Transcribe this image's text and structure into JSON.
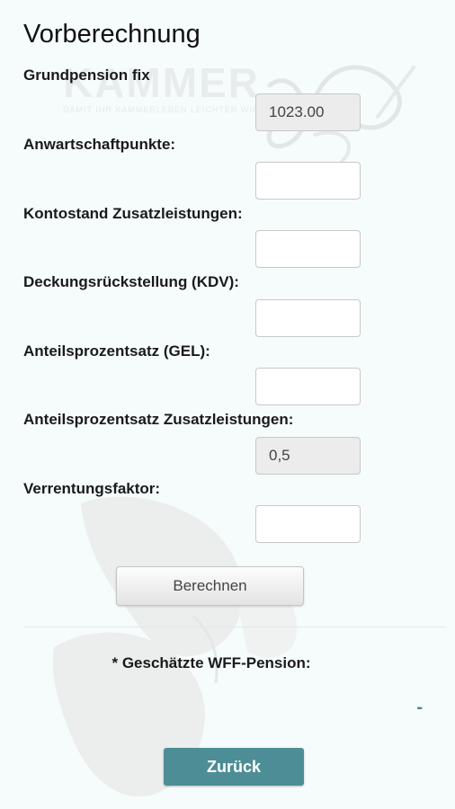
{
  "page": {
    "title": "Vorberechnung"
  },
  "watermark": {
    "brand": "KAMMER",
    "tagline": "DAMIT IHR KAMMERLEBEN LEICHTER WIRD"
  },
  "form": {
    "fields": [
      {
        "label": "Grundpension fix",
        "value": "1023.00",
        "readonly": true
      },
      {
        "label": "Anwartschaftpunkte:",
        "value": "",
        "readonly": false
      },
      {
        "label": "Kontostand Zusatzleistungen:",
        "value": "",
        "readonly": false
      },
      {
        "label": "Deckungsrückstellung (KDV):",
        "value": "",
        "readonly": false
      },
      {
        "label": "Anteilsprozentsatz (GEL):",
        "value": "",
        "readonly": false
      },
      {
        "label": "Anteilsprozentsatz Zusatzleistungen:",
        "value": "0,5",
        "readonly": true
      },
      {
        "label": "Verrentungsfaktor:",
        "value": "",
        "readonly": false
      }
    ],
    "calculate_label": "Berechnen"
  },
  "result": {
    "label": "* Geschätzte WFF-Pension:",
    "value": "-"
  },
  "footer": {
    "back_label": "Zurück"
  },
  "colors": {
    "background": "#f6fbfb",
    "accent": "#4d8e96",
    "result_value": "#4a8a8a"
  }
}
